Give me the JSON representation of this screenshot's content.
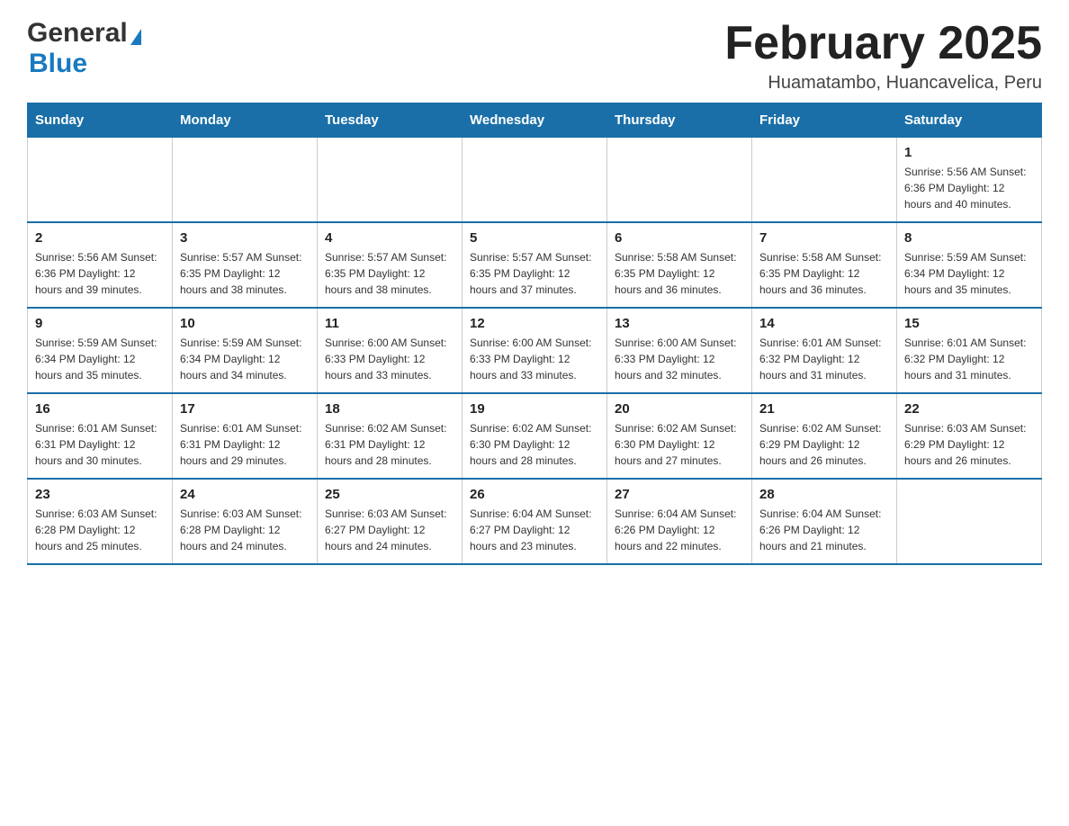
{
  "logo": {
    "general": "General",
    "blue": "Blue"
  },
  "header": {
    "title": "February 2025",
    "subtitle": "Huamatambo, Huancavelica, Peru"
  },
  "weekdays": [
    "Sunday",
    "Monday",
    "Tuesday",
    "Wednesday",
    "Thursday",
    "Friday",
    "Saturday"
  ],
  "weeks": [
    {
      "days": [
        {
          "num": "",
          "info": ""
        },
        {
          "num": "",
          "info": ""
        },
        {
          "num": "",
          "info": ""
        },
        {
          "num": "",
          "info": ""
        },
        {
          "num": "",
          "info": ""
        },
        {
          "num": "",
          "info": ""
        },
        {
          "num": "1",
          "info": "Sunrise: 5:56 AM\nSunset: 6:36 PM\nDaylight: 12 hours and 40 minutes."
        }
      ]
    },
    {
      "days": [
        {
          "num": "2",
          "info": "Sunrise: 5:56 AM\nSunset: 6:36 PM\nDaylight: 12 hours and 39 minutes."
        },
        {
          "num": "3",
          "info": "Sunrise: 5:57 AM\nSunset: 6:35 PM\nDaylight: 12 hours and 38 minutes."
        },
        {
          "num": "4",
          "info": "Sunrise: 5:57 AM\nSunset: 6:35 PM\nDaylight: 12 hours and 38 minutes."
        },
        {
          "num": "5",
          "info": "Sunrise: 5:57 AM\nSunset: 6:35 PM\nDaylight: 12 hours and 37 minutes."
        },
        {
          "num": "6",
          "info": "Sunrise: 5:58 AM\nSunset: 6:35 PM\nDaylight: 12 hours and 36 minutes."
        },
        {
          "num": "7",
          "info": "Sunrise: 5:58 AM\nSunset: 6:35 PM\nDaylight: 12 hours and 36 minutes."
        },
        {
          "num": "8",
          "info": "Sunrise: 5:59 AM\nSunset: 6:34 PM\nDaylight: 12 hours and 35 minutes."
        }
      ]
    },
    {
      "days": [
        {
          "num": "9",
          "info": "Sunrise: 5:59 AM\nSunset: 6:34 PM\nDaylight: 12 hours and 35 minutes."
        },
        {
          "num": "10",
          "info": "Sunrise: 5:59 AM\nSunset: 6:34 PM\nDaylight: 12 hours and 34 minutes."
        },
        {
          "num": "11",
          "info": "Sunrise: 6:00 AM\nSunset: 6:33 PM\nDaylight: 12 hours and 33 minutes."
        },
        {
          "num": "12",
          "info": "Sunrise: 6:00 AM\nSunset: 6:33 PM\nDaylight: 12 hours and 33 minutes."
        },
        {
          "num": "13",
          "info": "Sunrise: 6:00 AM\nSunset: 6:33 PM\nDaylight: 12 hours and 32 minutes."
        },
        {
          "num": "14",
          "info": "Sunrise: 6:01 AM\nSunset: 6:32 PM\nDaylight: 12 hours and 31 minutes."
        },
        {
          "num": "15",
          "info": "Sunrise: 6:01 AM\nSunset: 6:32 PM\nDaylight: 12 hours and 31 minutes."
        }
      ]
    },
    {
      "days": [
        {
          "num": "16",
          "info": "Sunrise: 6:01 AM\nSunset: 6:31 PM\nDaylight: 12 hours and 30 minutes."
        },
        {
          "num": "17",
          "info": "Sunrise: 6:01 AM\nSunset: 6:31 PM\nDaylight: 12 hours and 29 minutes."
        },
        {
          "num": "18",
          "info": "Sunrise: 6:02 AM\nSunset: 6:31 PM\nDaylight: 12 hours and 28 minutes."
        },
        {
          "num": "19",
          "info": "Sunrise: 6:02 AM\nSunset: 6:30 PM\nDaylight: 12 hours and 28 minutes."
        },
        {
          "num": "20",
          "info": "Sunrise: 6:02 AM\nSunset: 6:30 PM\nDaylight: 12 hours and 27 minutes."
        },
        {
          "num": "21",
          "info": "Sunrise: 6:02 AM\nSunset: 6:29 PM\nDaylight: 12 hours and 26 minutes."
        },
        {
          "num": "22",
          "info": "Sunrise: 6:03 AM\nSunset: 6:29 PM\nDaylight: 12 hours and 26 minutes."
        }
      ]
    },
    {
      "days": [
        {
          "num": "23",
          "info": "Sunrise: 6:03 AM\nSunset: 6:28 PM\nDaylight: 12 hours and 25 minutes."
        },
        {
          "num": "24",
          "info": "Sunrise: 6:03 AM\nSunset: 6:28 PM\nDaylight: 12 hours and 24 minutes."
        },
        {
          "num": "25",
          "info": "Sunrise: 6:03 AM\nSunset: 6:27 PM\nDaylight: 12 hours and 24 minutes."
        },
        {
          "num": "26",
          "info": "Sunrise: 6:04 AM\nSunset: 6:27 PM\nDaylight: 12 hours and 23 minutes."
        },
        {
          "num": "27",
          "info": "Sunrise: 6:04 AM\nSunset: 6:26 PM\nDaylight: 12 hours and 22 minutes."
        },
        {
          "num": "28",
          "info": "Sunrise: 6:04 AM\nSunset: 6:26 PM\nDaylight: 12 hours and 21 minutes."
        },
        {
          "num": "",
          "info": ""
        }
      ]
    }
  ]
}
